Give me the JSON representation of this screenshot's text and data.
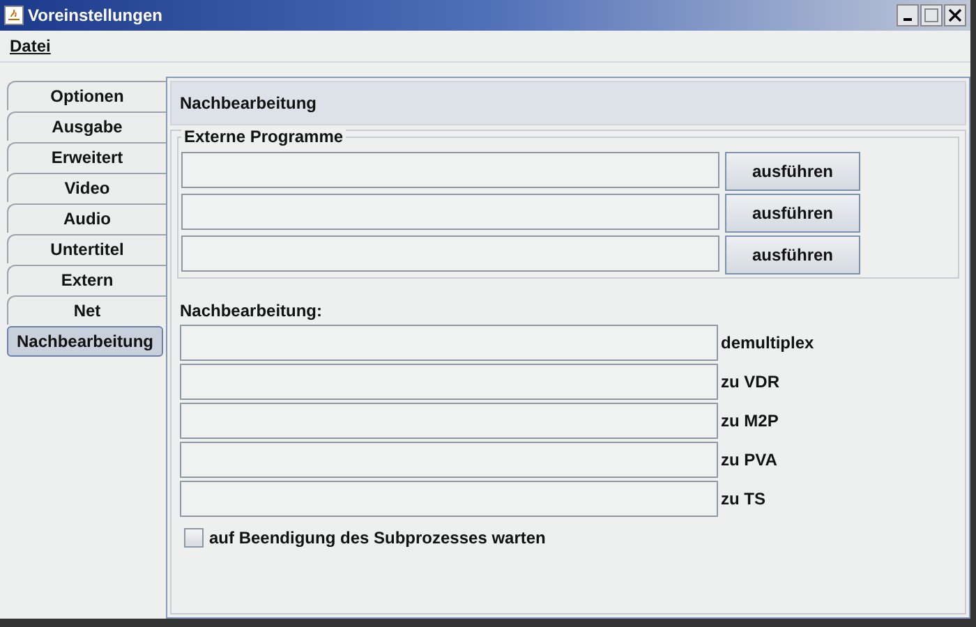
{
  "window": {
    "title": "Voreinstellungen"
  },
  "menu": [
    {
      "label": "Datei"
    }
  ],
  "tabs": [
    {
      "label": "Optionen",
      "selected": false
    },
    {
      "label": "Ausgabe",
      "selected": false
    },
    {
      "label": "Erweitert",
      "selected": false
    },
    {
      "label": "Video",
      "selected": false
    },
    {
      "label": "Audio",
      "selected": false
    },
    {
      "label": "Untertitel",
      "selected": false
    },
    {
      "label": "Extern",
      "selected": false
    },
    {
      "label": "Net",
      "selected": false
    },
    {
      "label": "Nachbearbeitung",
      "selected": true
    }
  ],
  "panel": {
    "title": "Nachbearbeitung",
    "external": {
      "title": "Externe Programme",
      "rows": [
        {
          "button": "ausführen"
        },
        {
          "button": "ausführen"
        },
        {
          "button": "ausführen"
        }
      ]
    },
    "post": {
      "title": "Nachbearbeitung:",
      "rows": [
        {
          "label": "demultiplex"
        },
        {
          "label": "zu VDR"
        },
        {
          "label": "zu M2P"
        },
        {
          "label": "zu PVA"
        },
        {
          "label": "zu TS"
        }
      ]
    },
    "wait": {
      "label": "auf Beendigung des Subprozesses warten",
      "checked": false
    }
  }
}
